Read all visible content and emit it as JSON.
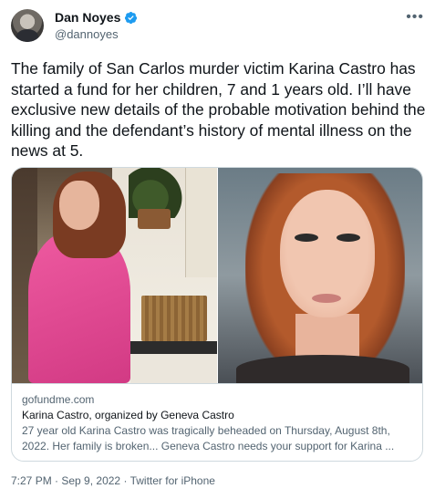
{
  "author": {
    "display_name": "Dan Noyes",
    "handle": "@dannoyes",
    "verified": true,
    "verified_color": "#1d9bf0"
  },
  "more_icon": "•••",
  "tweet_text": "The family of San Carlos murder victim Karina Castro has started a fund for her children, 7 and 1 years old. I’ll have exclusive new details of the probable motivation behind the killing and the defendant’s history of mental illness on the news at 5.",
  "card": {
    "domain": "gofundme.com",
    "title": "Karina Castro, organized by Geneva Castro",
    "description_line1": "27 year old Karina Castro was tragically beheaded on Thursday, August 8th,",
    "description_line2": "2022. Her family is broken... Geneva Castro needs your support for Karina ..."
  },
  "meta": {
    "time": "7:27 PM",
    "sep1": " · ",
    "date": "Sep 9, 2022",
    "sep2": " · ",
    "source": "Twitter for iPhone"
  }
}
